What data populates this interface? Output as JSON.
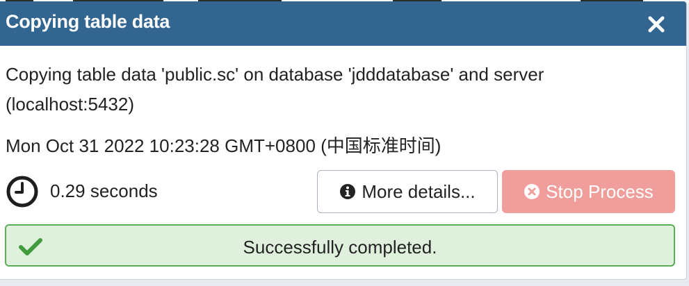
{
  "dialog": {
    "title": "Copying table data",
    "message": "Copying table data 'public.sc' on database 'jdddatabase' and server (localhost:5432)",
    "timestamp": "Mon Oct 31 2022 10:23:28 GMT+0800 (中国标准时间)",
    "elapsed": "0.29 seconds",
    "buttons": {
      "details_label": "More details...",
      "stop_label": "Stop Process"
    },
    "status": "Successfully completed."
  },
  "icons": {
    "close": "close-icon",
    "clock": "clock-icon",
    "info": "info-circle-icon",
    "stop": "times-circle-icon",
    "check": "check-icon"
  },
  "colors": {
    "header_bg": "#326690",
    "stop_button_bg": "#ef9e9b",
    "success_bg": "#dff1dd",
    "success_border": "#59ad55",
    "check_color": "#3f9b3b"
  }
}
